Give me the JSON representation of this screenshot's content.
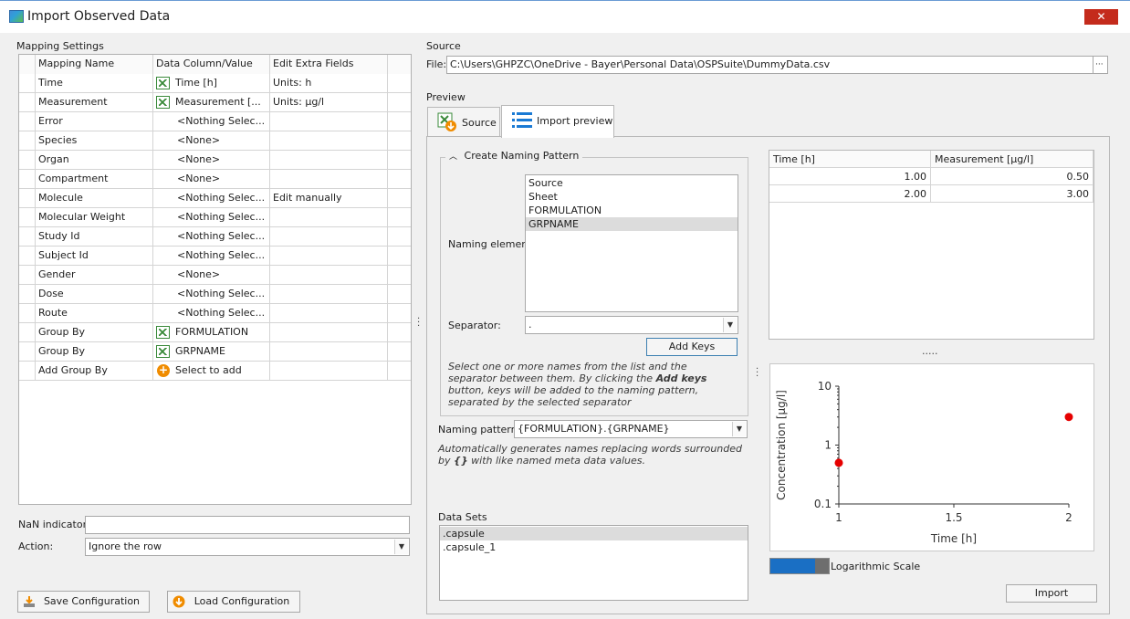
{
  "window": {
    "title": "Import Observed Data",
    "close_label": "✕"
  },
  "mapping": {
    "section_label": "Mapping Settings",
    "headers": {
      "name": "Mapping Name",
      "column": "Data Column/Value",
      "extra": "Edit Extra Fields"
    },
    "rows": [
      {
        "name": "Time",
        "value": "Time [h]",
        "extra": "Units: h",
        "icon": "excel-column-icon",
        "removable": true
      },
      {
        "name": "Measurement",
        "value": "Measurement [...",
        "extra": "Units: µg/l",
        "icon": "excel-column-icon",
        "removable": true
      },
      {
        "name": "Error",
        "value": "<Nothing Selec...",
        "extra": "",
        "icon": "",
        "removable": false
      },
      {
        "name": "Species",
        "value": "<None>",
        "extra": "",
        "icon": "",
        "removable": false
      },
      {
        "name": "Organ",
        "value": "<None>",
        "extra": "",
        "icon": "",
        "removable": false
      },
      {
        "name": "Compartment",
        "value": "<None>",
        "extra": "",
        "icon": "",
        "removable": false
      },
      {
        "name": "Molecule",
        "value": "<Nothing Selec...",
        "extra": "Edit manually",
        "icon": "",
        "removable": true
      },
      {
        "name": "Molecular Weight",
        "value": "<Nothing Selec...",
        "extra": "",
        "icon": "",
        "removable": false
      },
      {
        "name": "Study Id",
        "value": "<Nothing Selec...",
        "extra": "",
        "icon": "",
        "removable": false
      },
      {
        "name": "Subject Id",
        "value": "<Nothing Selec...",
        "extra": "",
        "icon": "",
        "removable": false
      },
      {
        "name": "Gender",
        "value": "<None>",
        "extra": "",
        "icon": "",
        "removable": false
      },
      {
        "name": "Dose",
        "value": "<Nothing Selec...",
        "extra": "",
        "icon": "",
        "removable": false
      },
      {
        "name": "Route",
        "value": "<Nothing Selec...",
        "extra": "",
        "icon": "",
        "removable": false
      },
      {
        "name": "Group By",
        "value": "FORMULATION",
        "extra": "",
        "icon": "excel-column-icon",
        "removable": true
      },
      {
        "name": "Group By",
        "value": "GRPNAME",
        "extra": "",
        "icon": "excel-column-icon",
        "removable": true
      },
      {
        "name": "Add Group By",
        "value": "Select to add",
        "extra": "",
        "icon": "add-icon",
        "removable": false
      }
    ],
    "nan_label": "NaN indicator:",
    "nan_value": "",
    "action_label": "Action:",
    "action_value": "Ignore the row",
    "save_label": "Save Configuration",
    "load_label": "Load Configuration"
  },
  "source": {
    "section_label": "Source",
    "file_label": "File:",
    "file_path": "C:\\Users\\GHPZC\\OneDrive - Bayer\\Personal Data\\OSPSuite\\DummyData.csv",
    "browse_label": "···"
  },
  "preview": {
    "section_label": "Preview",
    "tabs": [
      {
        "label": "Source",
        "icon": "excel-import-icon"
      },
      {
        "label": "Import preview",
        "icon": "list-icon"
      }
    ],
    "naming": {
      "group_label": "Create Naming Pattern",
      "element_label": "Naming element:",
      "elements": [
        "Source",
        "Sheet",
        "FORMULATION",
        "GRPNAME"
      ],
      "selected_element": "GRPNAME",
      "separator_label": "Separator:",
      "separator_value": ".",
      "add_keys_label": "Add Keys",
      "help_part1": "Select one or more names from the list and the separator between them. By clicking the ",
      "help_bold": "Add keys",
      "help_part2": " button, keys will be added to the naming pattern, separated by the selected separator",
      "pattern_label": "Naming pattern:",
      "pattern_value": "{FORMULATION}.{GRPNAME}",
      "pattern_help_part1": "Automatically generates names replacing words surrounded by ",
      "pattern_help_bold": "{}",
      "pattern_help_part2": " with like named meta data values."
    },
    "datasets": {
      "label": "Data Sets",
      "items": [
        ".capsule",
        ".capsule_1"
      ],
      "selected": ".capsule"
    },
    "table": {
      "headers": [
        "Time [h]",
        "Measurement [µg/l]"
      ],
      "rows": [
        [
          "1.00",
          "0.50"
        ],
        [
          "2.00",
          "3.00"
        ]
      ]
    },
    "splitter_label": ".....",
    "log_scale_label": "Logarithmic Scale",
    "import_label": "Import"
  },
  "chart_data": {
    "type": "scatter",
    "xlabel": "Time [h]",
    "ylabel": "Concentration [µg/l]",
    "x_ticks": [
      "1",
      "1.5",
      "2"
    ],
    "y_ticks": [
      "10",
      "1",
      "0.1"
    ],
    "xlim": [
      1,
      2
    ],
    "ylim": [
      0.1,
      10
    ],
    "y_scale": "log",
    "series": [
      {
        "x": [
          1,
          2
        ],
        "y": [
          0.5,
          3
        ],
        "color": "#e60000"
      }
    ]
  }
}
